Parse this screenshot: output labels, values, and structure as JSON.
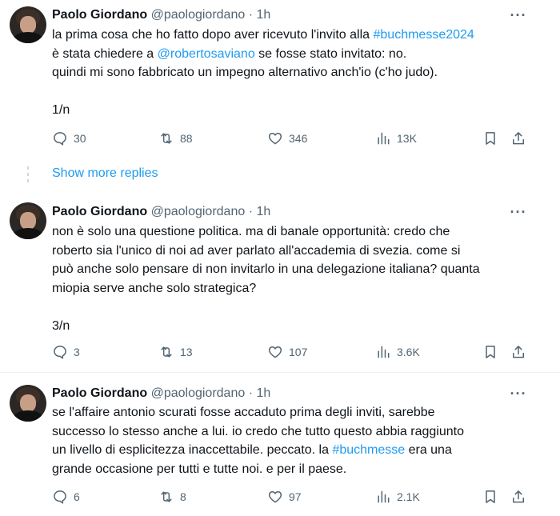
{
  "tweets": [
    {
      "name": "Paolo Giordano",
      "handle": "@paologiordano",
      "time": "· 1h",
      "lines": [
        [
          {
            "t": "la prima cosa che ho fatto dopo aver ricevuto l'invito alla "
          },
          {
            "t": "#buchmesse2024",
            "link": true
          }
        ],
        [
          {
            "t": "è stata chiedere a "
          },
          {
            "t": "@robertosaviano",
            "link": true
          },
          {
            "t": " se fosse stato invitato: no."
          }
        ],
        [
          {
            "t": "quindi mi sono fabbricato un impegno alternativo anch'io (c'ho judo)."
          }
        ],
        [
          {
            "t": ""
          }
        ],
        [
          {
            "t": "1/n"
          }
        ]
      ],
      "replies": "30",
      "retweets": "88",
      "likes": "346",
      "views": "13K"
    },
    {
      "name": "Paolo Giordano",
      "handle": "@paologiordano",
      "time": "· 1h",
      "lines": [
        [
          {
            "t": "non è solo una questione politica. ma di banale opportunità: credo che"
          }
        ],
        [
          {
            "t": "roberto sia l'unico di noi ad aver parlato all'accademia di svezia. come si"
          }
        ],
        [
          {
            "t": "può anche solo pensare di non invitarlo in una delegazione italiana? quanta"
          }
        ],
        [
          {
            "t": "miopia serve anche solo strategica?"
          }
        ],
        [
          {
            "t": ""
          }
        ],
        [
          {
            "t": "3/n"
          }
        ]
      ],
      "replies": "3",
      "retweets": "13",
      "likes": "107",
      "views": "3.6K"
    },
    {
      "name": "Paolo Giordano",
      "handle": "@paologiordano",
      "time": "· 1h",
      "lines": [
        [
          {
            "t": "se l'affaire antonio scurati fosse accaduto prima degli inviti, sarebbe"
          }
        ],
        [
          {
            "t": "successo lo stesso anche a lui. io credo che tutto questo abbia raggiunto"
          }
        ],
        [
          {
            "t": "un livello di esplicitezza inaccettabile. peccato. la "
          },
          {
            "t": "#buchmesse",
            "link": true
          },
          {
            "t": " era una"
          }
        ],
        [
          {
            "t": "grande occasione per tutti e tutte noi. e per il paese."
          }
        ]
      ],
      "replies": "6",
      "retweets": "8",
      "likes": "97",
      "views": "2.1K"
    }
  ],
  "show_more": "Show more replies",
  "more_label": "···",
  "colors": {
    "link": "#1d9bf0",
    "secondary": "#536471",
    "text": "#0f1419"
  }
}
